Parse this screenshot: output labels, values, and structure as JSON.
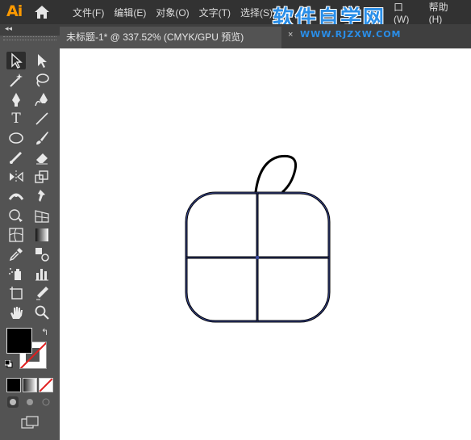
{
  "app": {
    "logo": "Ai"
  },
  "menu": {
    "items": [
      "文件(F)",
      "编辑(E)",
      "对象(O)",
      "文字(T)",
      "选择(S)"
    ],
    "right_items": [
      "口(W)",
      "帮助(H)"
    ]
  },
  "watermark": {
    "title": "软件自学网",
    "url": "WWW.RJZXW.COM"
  },
  "document": {
    "tab_title": "未标题-1* @ 337.52% (CMYK/GPU 预览)",
    "close_glyph": "×"
  },
  "toolbar": {
    "collapse_glyph": "◂◂",
    "swap_glyph": "↰",
    "type_tool_glyph": "T",
    "tools": [
      "selection-tool",
      "direct-selection-tool",
      "magic-wand-tool",
      "lasso-tool",
      "pen-tool",
      "curvature-tool",
      "type-tool",
      "line-segment-tool",
      "ellipse-tool",
      "paintbrush-tool",
      "shaper-tool",
      "eraser-tool",
      "reflect-tool",
      "scale-tool",
      "width-tool",
      "puppet-warp-tool",
      "shape-builder-tool",
      "perspective-grid-tool",
      "mesh-tool",
      "gradient-tool",
      "eyedropper-tool",
      "blend-tool",
      "symbol-sprayer-tool",
      "column-graph-tool",
      "artboard-tool",
      "slice-tool",
      "hand-tool",
      "zoom-tool"
    ],
    "fill_color": "#000000",
    "stroke_color": "none"
  },
  "colors": {
    "menubar": "#323232",
    "panel": "#535353",
    "canvas": "#ffffff",
    "selection_outline": "#3a4a9a",
    "path": "#000000",
    "logo": "#ff9a00",
    "watermark": "#2a8ee8"
  }
}
